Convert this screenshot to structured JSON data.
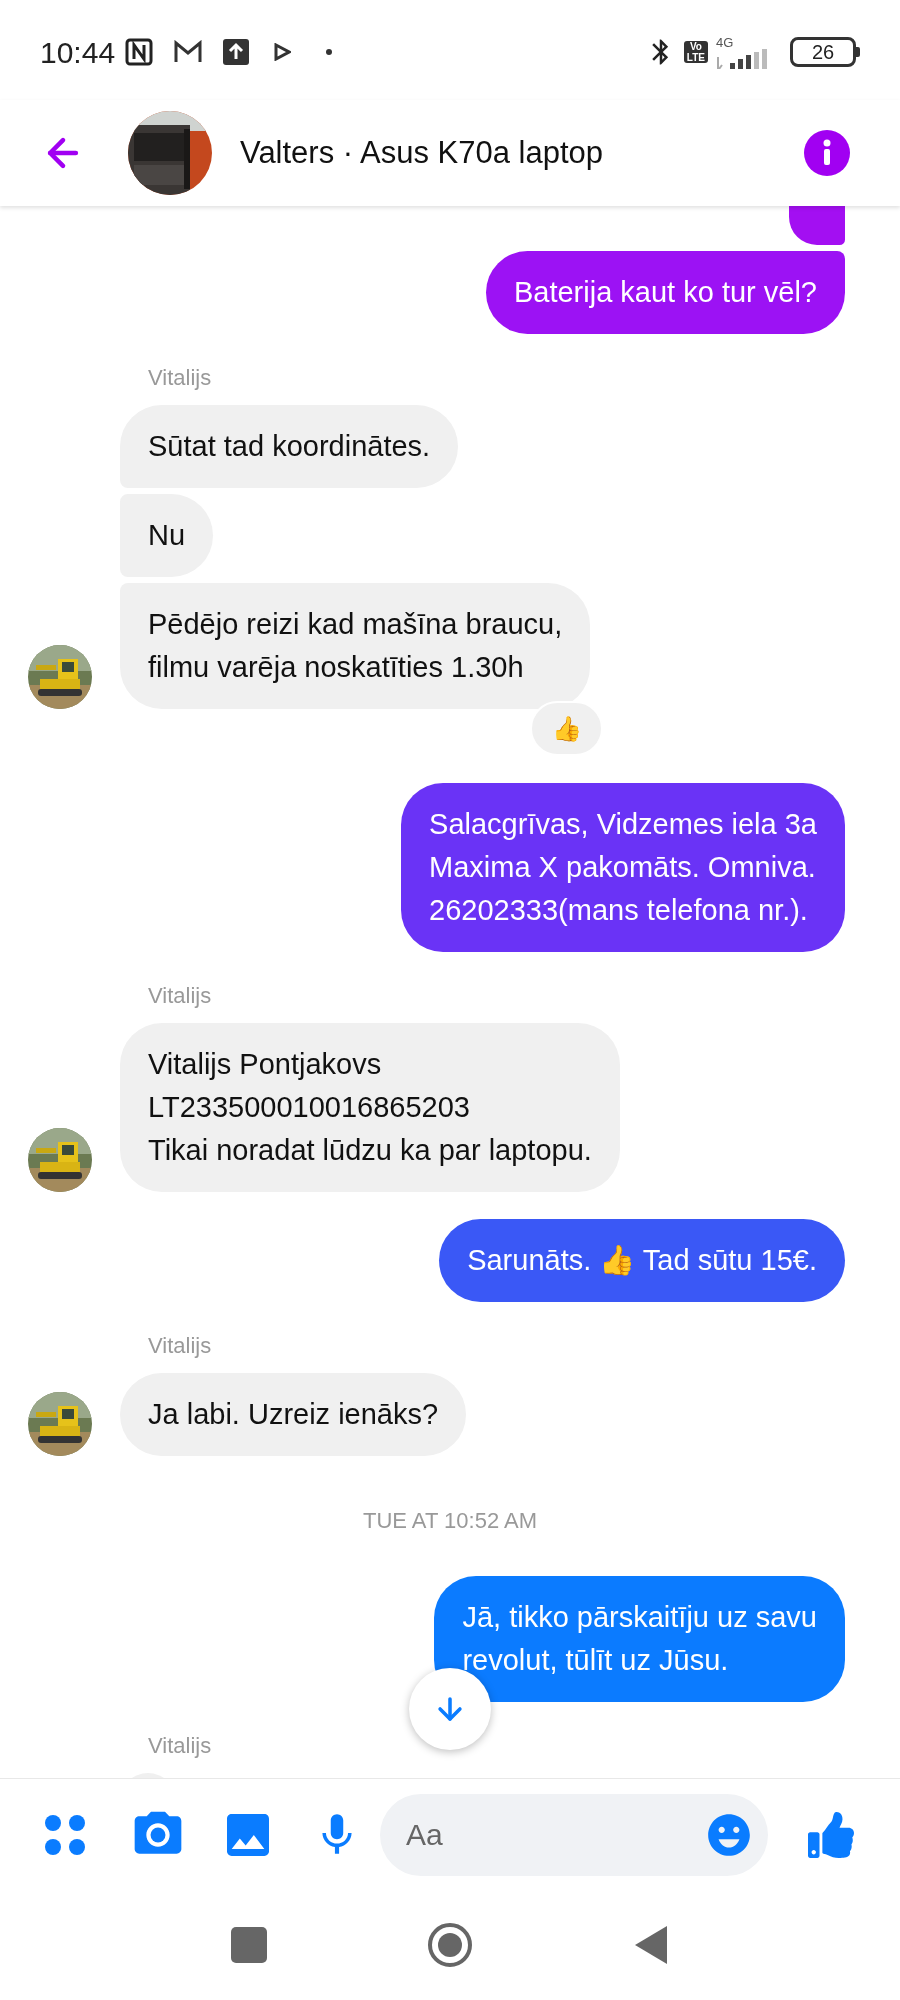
{
  "status_bar": {
    "time": "10:44",
    "volte": [
      "Vo",
      "LTE"
    ],
    "network": "4G",
    "battery": "26"
  },
  "header": {
    "title": "Valters · Asus K70a laptop"
  },
  "messages": [
    {
      "kind": "sent",
      "color": "#a30ff2"
    },
    {
      "kind": "sent",
      "text": "Baterija kaut ko tur vēl?",
      "color": "#9c12f4"
    },
    {
      "kind": "label",
      "text": "Vitalijs"
    },
    {
      "kind": "received",
      "text": "Sūtat tad koordinātes.",
      "avatar": false
    },
    {
      "kind": "received",
      "text": "Nu",
      "avatar": false
    },
    {
      "kind": "received",
      "text": "Pēdējo reizi kad mašīna braucu,\nfilmu varēja noskatīties 1.30h",
      "avatar": true,
      "reaction": "👍"
    },
    {
      "kind": "sent",
      "text": "Salacgrīvas, Vidzemes iela 3a\nMaxima X pakomāts. Omniva.\n26202333(mans telefona nr.).",
      "color": "#6a33f6"
    },
    {
      "kind": "label",
      "text": "Vitalijs"
    },
    {
      "kind": "received",
      "text": "Vitalijs Pontjakovs\nLT233500010016865203\nTikai noradat lūdzu ka par laptopu.",
      "avatar": true
    },
    {
      "kind": "sent",
      "text": "Sarunāts. 👍 Tad sūtu 15€.",
      "color": "#3a58f6"
    },
    {
      "kind": "label",
      "text": "Vitalijs"
    },
    {
      "kind": "received",
      "text": "Ja labi. Uzreiz ienāks?",
      "avatar": true
    },
    {
      "kind": "timestamp",
      "text": "TUE AT 10:52 AM"
    },
    {
      "kind": "sent",
      "text": "Jā, tikko pārskaitīju uz savu\nrevolut, tūlīt uz Jūsu.",
      "color": "#0b7bff"
    },
    {
      "kind": "label",
      "text": "Vitalijs"
    },
    {
      "kind": "received",
      "avatar": false
    }
  ],
  "composer": {
    "placeholder": "Aa"
  }
}
